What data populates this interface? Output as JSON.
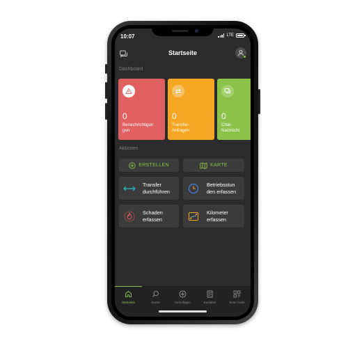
{
  "status_bar": {
    "time": "10:07",
    "network": "LTE"
  },
  "header": {
    "title": "Startseite"
  },
  "dashboard": {
    "section_label": "Dashboard",
    "cards": [
      {
        "count": "0",
        "label": "Benachrichtigun\ngen",
        "color": "#e0605f",
        "icon": "warning-triangle-icon"
      },
      {
        "count": "0",
        "label": "Transfer-\nAnfragen",
        "color": "#f5a623",
        "icon": "swap-arrows-icon"
      },
      {
        "count": "0",
        "label": "Chat-\nNachricht",
        "color": "#8bc34a",
        "icon": "chat-bubbles-icon"
      }
    ]
  },
  "actions": {
    "section_label": "Aktionen",
    "create_label": "ERSTELLEN",
    "map_label": "KARTE",
    "tiles": [
      {
        "label": "Transfer\ndurchführen",
        "icon": "transfer-arrows-icon",
        "color": "#26c6da"
      },
      {
        "label": "Betriebsstun\nden erfassen",
        "icon": "clock-icon",
        "color": "#4a7fe0"
      },
      {
        "label": "Schaden\nerfassen",
        "icon": "flame-icon",
        "color": "#e0605f"
      },
      {
        "label": "Kilometer\nerfassen",
        "icon": "route-icon",
        "color": "#f5a623"
      }
    ]
  },
  "bottom_nav": {
    "items": [
      {
        "label": "Startseite",
        "icon": "home-icon",
        "active": true
      },
      {
        "label": "Suche",
        "icon": "search-icon",
        "active": false
      },
      {
        "label": "Hinzufügen",
        "icon": "add-circle-icon",
        "active": false
      },
      {
        "label": "Kontakte",
        "icon": "contacts-icon",
        "active": false
      },
      {
        "label": "Scan Code",
        "icon": "qr-code-icon",
        "active": false
      }
    ]
  },
  "colors": {
    "accent": "#8bc34a",
    "background": "#2b2b2b",
    "tile": "#3b3b3b"
  }
}
